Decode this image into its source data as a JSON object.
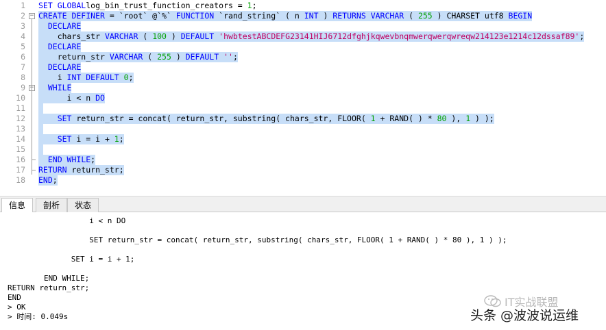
{
  "editor": {
    "lines": [
      {
        "n": "1",
        "fold": "",
        "segs": [
          [
            "kw",
            "SET GLOBAL"
          ],
          [
            "",
            "log_bin_trust_function_creators = "
          ],
          [
            "num",
            "1"
          ],
          [
            "",
            ";"
          ]
        ]
      },
      {
        "n": "2",
        "fold": "−",
        "segs": [
          [
            "kw",
            "CREATE DEFINER"
          ],
          [
            "",
            " = `root` @`%` "
          ],
          [
            "kw",
            "FUNCTION"
          ],
          [
            "",
            " `rand_string` ( n "
          ],
          [
            "kw",
            "INT"
          ],
          [
            "",
            " ) "
          ],
          [
            "kw",
            "RETURNS VARCHAR"
          ],
          [
            "",
            " ( "
          ],
          [
            "num",
            "255"
          ],
          [
            "",
            " ) CHARSET utf8 "
          ],
          [
            "kw",
            "BEGIN"
          ]
        ]
      },
      {
        "n": "3",
        "fold": "",
        "segs": [
          [
            "",
            "  "
          ],
          [
            "kw",
            "DECLARE"
          ]
        ]
      },
      {
        "n": "4",
        "fold": "",
        "segs": [
          [
            "",
            "    chars_str "
          ],
          [
            "kw",
            "VARCHAR"
          ],
          [
            "",
            " ( "
          ],
          [
            "num",
            "100"
          ],
          [
            "",
            " ) "
          ],
          [
            "kw",
            "DEFAULT"
          ],
          [
            "",
            " "
          ],
          [
            "str",
            "'hwbtestABCDEFG23141HIJ6712dfghjkqwevbnqmwerqwerqwreqw214123e1214c12dssaf89'"
          ],
          [
            "",
            ";"
          ]
        ]
      },
      {
        "n": "5",
        "fold": "",
        "segs": [
          [
            "",
            "  "
          ],
          [
            "kw",
            "DECLARE"
          ]
        ]
      },
      {
        "n": "6",
        "fold": "",
        "segs": [
          [
            "",
            "    return_str "
          ],
          [
            "kw",
            "VARCHAR"
          ],
          [
            "",
            " ( "
          ],
          [
            "num",
            "255"
          ],
          [
            "",
            " ) "
          ],
          [
            "kw",
            "DEFAULT"
          ],
          [
            "",
            " "
          ],
          [
            "str",
            "''"
          ],
          [
            "",
            ";"
          ]
        ]
      },
      {
        "n": "7",
        "fold": "",
        "segs": [
          [
            "",
            "  "
          ],
          [
            "kw",
            "DECLARE"
          ]
        ]
      },
      {
        "n": "8",
        "fold": "",
        "segs": [
          [
            "",
            "    i "
          ],
          [
            "kw",
            "INT DEFAULT"
          ],
          [
            "",
            " "
          ],
          [
            "num",
            "0"
          ],
          [
            "",
            ";"
          ]
        ]
      },
      {
        "n": "9",
        "fold": "−",
        "segs": [
          [
            "",
            "  "
          ],
          [
            "kw",
            "WHILE"
          ]
        ]
      },
      {
        "n": "10",
        "fold": "",
        "segs": [
          [
            "",
            "      i < n "
          ],
          [
            "kw",
            "DO"
          ]
        ]
      },
      {
        "n": "11",
        "fold": "",
        "segs": [
          [
            "",
            ""
          ]
        ]
      },
      {
        "n": "12",
        "fold": "",
        "segs": [
          [
            "",
            "    "
          ],
          [
            "kw",
            "SET"
          ],
          [
            "",
            " return_str = concat( return_str, substring( chars_str, FLOOR( "
          ],
          [
            "num",
            "1"
          ],
          [
            "",
            " + RAND( ) * "
          ],
          [
            "num",
            "80"
          ],
          [
            "",
            " ), "
          ],
          [
            "num",
            "1"
          ],
          [
            "",
            " ) );"
          ]
        ]
      },
      {
        "n": "13",
        "fold": "",
        "segs": [
          [
            "",
            ""
          ]
        ]
      },
      {
        "n": "14",
        "fold": "",
        "segs": [
          [
            "",
            "    "
          ],
          [
            "kw",
            "SET"
          ],
          [
            "",
            " i = i + "
          ],
          [
            "num",
            "1"
          ],
          [
            "",
            ";"
          ]
        ]
      },
      {
        "n": "15",
        "fold": "",
        "segs": [
          [
            "",
            ""
          ]
        ]
      },
      {
        "n": "16",
        "fold": "",
        "segs": [
          [
            "",
            "  "
          ],
          [
            "kw",
            "END WHILE"
          ],
          [
            "",
            ";"
          ]
        ]
      },
      {
        "n": "17",
        "fold": "",
        "segs": [
          [
            "kw",
            "RETURN"
          ],
          [
            "",
            " return_str;"
          ]
        ]
      },
      {
        "n": "18",
        "fold": "",
        "segs": [
          [
            "kw",
            "END"
          ],
          [
            "",
            ";"
          ]
        ]
      }
    ]
  },
  "tabs": {
    "info": "信息",
    "profile": "剖析",
    "status": "状态"
  },
  "output": {
    "lines": [
      "                  i < n DO",
      "",
      "                  SET return_str = concat( return_str, substring( chars_str, FLOOR( 1 + RAND( ) * 80 ), 1 ) );",
      "",
      "              SET i = i + 1;",
      "",
      "        END WHILE;",
      "RETURN return_str;",
      "END",
      "> OK",
      "> 时间: 0.049s"
    ]
  },
  "watermark": {
    "line1": "IT实战联盟",
    "line2": "头条 @波波说运维"
  },
  "colors": {
    "keyword": "#0000ff",
    "string": "#c00060",
    "number": "#00a000",
    "selection": "#c7def8"
  }
}
